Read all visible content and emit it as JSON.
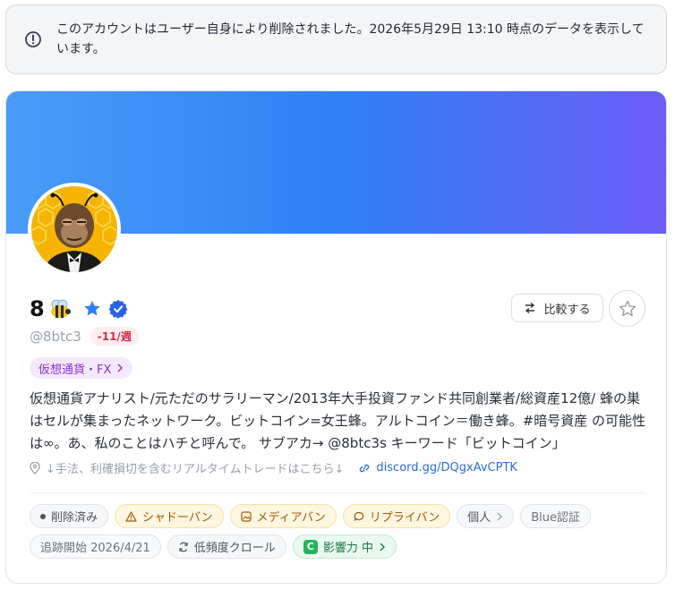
{
  "notice": {
    "text": "このアカウントはユーザー自身により削除されました。2026年5月29日 13:10 時点のデータを表示しています。"
  },
  "profile": {
    "name": "8",
    "handle": "@8btc3",
    "weekly_change": "-11/週",
    "category": "仮想通貨・FX",
    "bio": "仮想通貨アナリスト/元ただのサラリーマン/2013年大手投資ファンド共同創業者/総資産12億/ 蜂の巣はセルが集まったネットワーク。ビットコイン=女王蜂。アルトコイン＝働き蜂。#暗号資産 の可能性は∞。あ、私のことはハチと呼んで。 サブアカ→ @8btc3s キーワード「ビットコイン」",
    "location": "↓手法、利確損切を含むリアルタイムトレードはこちら↓",
    "link": "discord.gg/DQgxAvCPTK"
  },
  "actions": {
    "compare_label": "比較する"
  },
  "chips": [
    {
      "label": "削除済み",
      "style": "neutral",
      "icon": "dot-icon"
    },
    {
      "label": "シャドーバン",
      "style": "warn",
      "icon": "warning-icon"
    },
    {
      "label": "メディアバン",
      "style": "warn",
      "icon": "image-icon"
    },
    {
      "label": "リプライバン",
      "style": "warn",
      "icon": "chat-icon"
    },
    {
      "label": "個人",
      "style": "neutral",
      "icon": "chevron-right-icon"
    },
    {
      "label": "Blue認証",
      "style": "plain",
      "icon": ""
    },
    {
      "label": "追跡開始 2026/4/21",
      "style": "plain",
      "icon": ""
    },
    {
      "label": "低頻度クロール",
      "style": "neutral",
      "icon": "refresh-icon"
    },
    {
      "label": "影響力 中",
      "style": "green",
      "icon": "c-grade-icon",
      "grade": "C"
    }
  ],
  "colors": {
    "banner_start": "#4a9cf8",
    "banner_end": "#6a5cf6",
    "verified_blue": "#2563eb",
    "warn_text": "#a05b08",
    "danger": "#dc2645"
  }
}
